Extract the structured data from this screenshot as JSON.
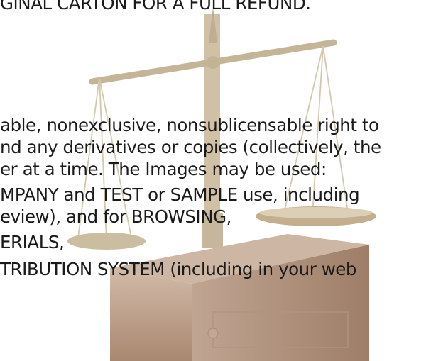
{
  "document": {
    "lines": [
      "GINAL CARTON FOR A FULL REFUND.",
      "able, nonexclusive, nonsublicensable right to",
      "nd any derivatives or copies (collectively, the",
      "er at a time. The Images may be used:",
      "MPANY and TEST or SAMPLE use, including",
      "eview), and for BROWSING,",
      "ERIALS,",
      "TRIBUTION SYSTEM (including in your web"
    ]
  },
  "background": {
    "image": "balance-scale-illustration",
    "colors": {
      "brass": "#c9bba2",
      "wood": "#b49884",
      "page": "#ffffff",
      "text": "#1a1a1a"
    }
  }
}
